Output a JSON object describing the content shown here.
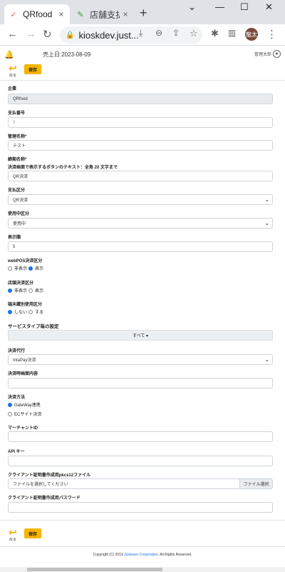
{
  "browser": {
    "tabs": [
      {
        "label": "QRfood",
        "close": "×"
      },
      {
        "label": "店舗支払方法",
        "close": "×"
      }
    ],
    "new_tab": "+",
    "window_controls": {
      "dropdown": "⌄",
      "minimize": "—",
      "maximize": "☐",
      "close": "✕"
    },
    "url": "kioskdev.just...",
    "avatar_text": "龍太"
  },
  "header": {
    "sale_date": "売上日:2023-08-09",
    "user_label": "管理太郎"
  },
  "actions": {
    "back_label": "戻る",
    "save_label": "保存"
  },
  "form": {
    "company_label": "企業",
    "company_value": "QRfood",
    "payment_no_label": "支払番号",
    "payment_no_value": "5",
    "admin_name_label": "管理名称*",
    "admin_name_value": "テスト",
    "display_name_label": "締期名称*",
    "button_text_label": "決済画面で表示するボタンのテキスト：全角 20 文字まで",
    "button_text_value": "QR決済",
    "payment_type_label": "支払区分",
    "payment_type_value": "QR決済",
    "usage_label": "使用中区分",
    "usage_value": "使用中",
    "display_order_label": "表示順",
    "display_order_value": "5",
    "webpos_label": "webPOS決済区分",
    "webpos_options": [
      "非表示",
      "表示"
    ],
    "store_label": "店頭決済区分",
    "store_options": [
      "非表示",
      "表示"
    ],
    "terminal_label": "端末識別使用区分",
    "terminal_options": [
      "しない",
      "する"
    ],
    "service_section": "サービスタイプ毎の設定",
    "service_all": "すべて ▾",
    "agent_label": "決済代行",
    "agent_value": "IntaPay決済",
    "payment_content_label": "決済時画面内容",
    "payment_method_label": "決済方法",
    "payment_method_options": [
      "GateWay連携",
      "ECサイト決済"
    ],
    "merchant_label": "マーチャントID",
    "api_key_label": "API キー",
    "cert_file_label": "クライアント証明書作成用pkcs12ファイル",
    "cert_file_placeholder": "ファイルを選択してください",
    "cert_file_button": "ファイル選択",
    "cert_pw_label": "クライアント証明書作成用パスワード"
  },
  "footer": {
    "pre": "Copyright (C) 2019 ",
    "brand": "Justware Corporation",
    "post": ". All Rights Reserved."
  },
  "colors": {
    "accent": "#f6b400",
    "radio_on": "#1a73e8"
  }
}
